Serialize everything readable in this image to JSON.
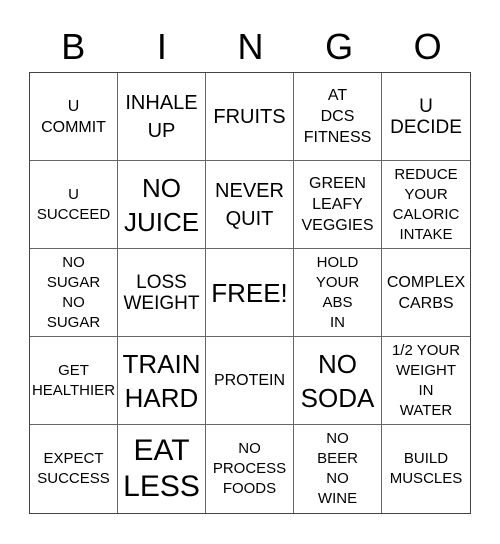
{
  "header": {
    "letters": [
      "B",
      "I",
      "N",
      "G",
      "O"
    ]
  },
  "board": {
    "cells": [
      "U\nCOMMIT",
      "INHALE\nUP",
      "FRUITS",
      "AT\nDCS\nFITNESS",
      "U\nDECIDE",
      "U\nSUCCEED",
      "NO\nJUICE",
      "NEVER\nQUIT",
      "GREEN\nLEAFY\nVEGGIES",
      "REDUCE\nYOUR\nCALORIC\nINTAKE",
      "NO\nSUGAR\nNO\nSUGAR",
      "LOSS\nWEIGHT",
      "FREE!",
      "HOLD\nYOUR\nABS\nIN",
      "COMPLEX\nCARBS",
      "GET\nHEALTHIER",
      "TRAIN\nHARD",
      "PROTEIN",
      "NO\nSODA",
      "1/2 YOUR\nWEIGHT\nIN\nWATER",
      "EXPECT\nSUCCESS",
      "EAT\nLESS",
      "NO\nPROCESS\nFOODS",
      "NO\nBEER\nNO\nWINE",
      "BUILD\nMUSCLES"
    ]
  }
}
